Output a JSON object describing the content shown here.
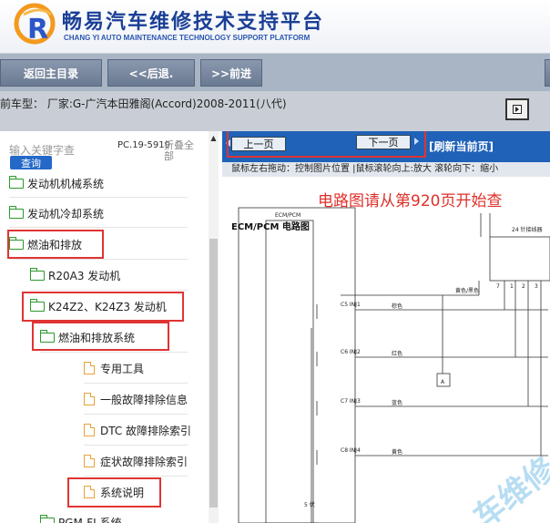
{
  "header": {
    "title_cn": "畅易汽车维修技术支持平台",
    "title_en": "CHANG YI AUTO MAINTENANCE TECHNOLOGY SUPPORT PLATFORM"
  },
  "nav": {
    "home": "返回主目录",
    "back": "<<后退.",
    "forward": ">>前进"
  },
  "car": {
    "info": "前车型：  厂家:G-广汽本田雅阁(Accord)2008-2011(八代)"
  },
  "search": {
    "placeholder": "输入关键字查",
    "button": "查询",
    "pc_label": "PC.19-5919",
    "collapse_label": "折叠全部"
  },
  "tree": {
    "items": [
      {
        "label": "发动机机械系统",
        "type": "folder"
      },
      {
        "label": "发动机冷却系统",
        "type": "folder"
      },
      {
        "label": "燃油和排放",
        "type": "folder"
      },
      {
        "label": "R20A3 发动机",
        "type": "folder"
      },
      {
        "label": "K24Z2、K24Z3 发动机",
        "type": "folder"
      },
      {
        "label": "燃油和排放系统",
        "type": "folder"
      },
      {
        "label": "专用工具",
        "type": "doc"
      },
      {
        "label": "一般故障排除信息",
        "type": "doc"
      },
      {
        "label": "DTC 故障排除索引",
        "type": "doc"
      },
      {
        "label": "症状故障排除索引",
        "type": "doc"
      },
      {
        "label": "系统说明",
        "type": "doc"
      },
      {
        "label": "PGM-FI 系统",
        "type": "folder"
      }
    ]
  },
  "pager": {
    "prev": "上一页",
    "next": "下一页",
    "refresh": "[刷新当前页]",
    "hint": "鼠标左右拖动：控制图片位置 |鼠标滚轮向上:放大  滚轮向下：缩小"
  },
  "diagram": {
    "note": "电路图请从第920页开始查",
    "title": "ECM/PCM 电路图",
    "box_label": "ECM/PCM",
    "connector_label": "24 针接线器",
    "pins": [
      "C5 INJ1",
      "C6 INJ2",
      "C7 INJ3",
      "C8 INJ4"
    ],
    "wire_colors": [
      "棕色",
      "红色",
      "蓝色",
      "黄色"
    ],
    "wire_top": "黄色/黑色",
    "conn_pins": [
      "7",
      "1",
      "2",
      "3"
    ],
    "marker": "A",
    "power": "5 伏",
    "watermark": "车维修"
  }
}
